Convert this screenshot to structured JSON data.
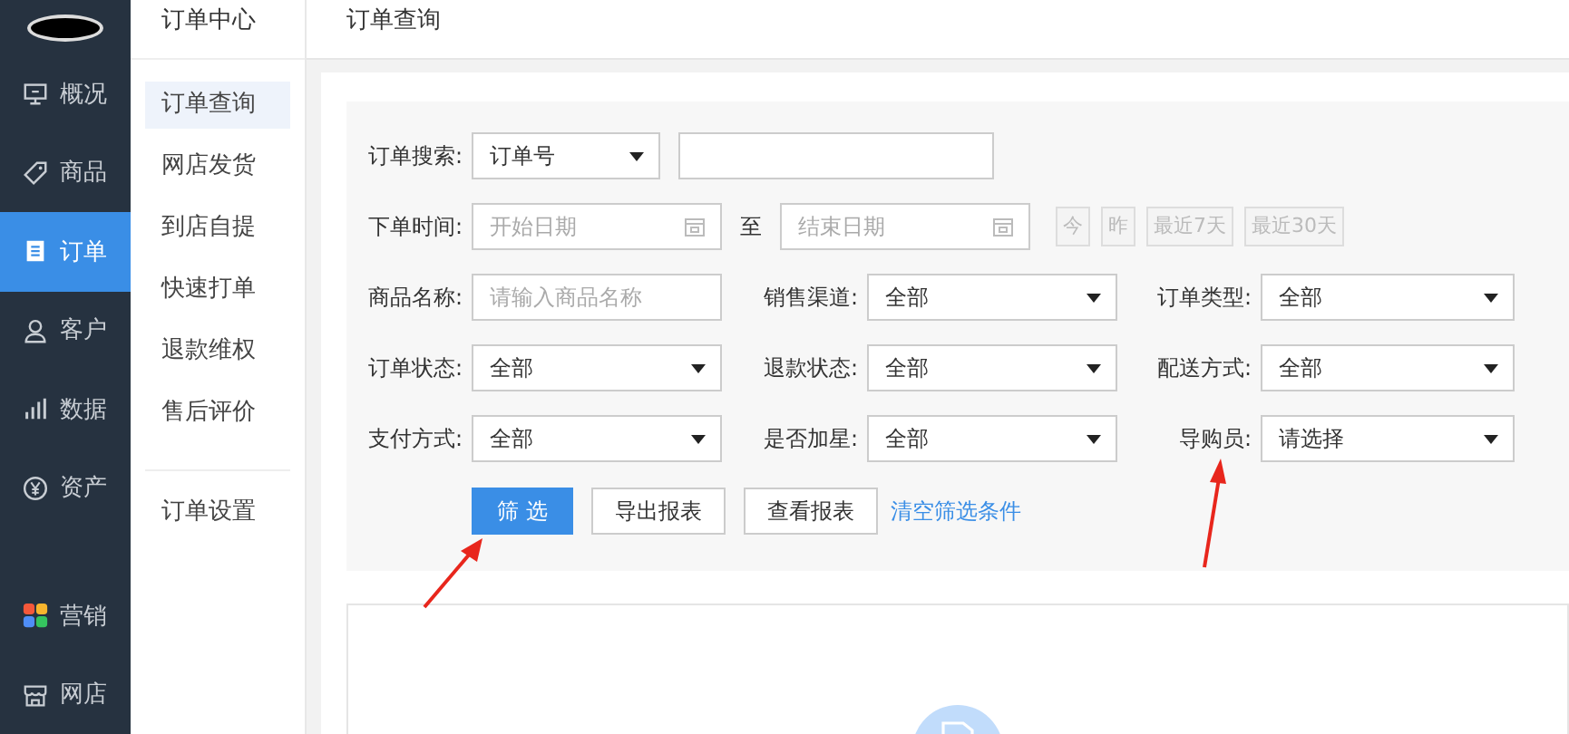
{
  "main_nav": [
    {
      "label": "概况",
      "selected": false
    },
    {
      "label": "商品",
      "selected": false
    },
    {
      "label": "订单",
      "selected": true
    },
    {
      "label": "客户",
      "selected": false
    },
    {
      "label": "数据",
      "selected": false
    },
    {
      "label": "资产",
      "selected": false
    },
    {
      "label": "营销",
      "selected": false
    },
    {
      "label": "网店",
      "selected": false
    }
  ],
  "sub_nav": {
    "title": "订单中心",
    "groups": [
      [
        {
          "label": "订单查询",
          "selected": true
        },
        {
          "label": "网店发货",
          "selected": false
        },
        {
          "label": "到店自提",
          "selected": false
        },
        {
          "label": "快速打单",
          "selected": false
        },
        {
          "label": "退款维权",
          "selected": false
        },
        {
          "label": "售后评价",
          "selected": false
        }
      ],
      [
        {
          "label": "订单设置",
          "selected": false
        }
      ]
    ]
  },
  "page_title": "订单查询",
  "filter": {
    "order_search": {
      "label": "订单搜索:",
      "type_select": "订单号"
    },
    "order_time": {
      "label": "下单时间:",
      "start_placeholder": "开始日期",
      "separator": "至",
      "end_placeholder": "结束日期",
      "quick_dates": [
        {
          "label": "今",
          "disabled": true
        },
        {
          "label": "昨",
          "disabled": true
        },
        {
          "label": "最近7天",
          "disabled": true
        },
        {
          "label": "最近30天",
          "disabled": true
        }
      ]
    },
    "fields": [
      [
        {
          "label": "商品名称:",
          "kind": "text",
          "placeholder": "请输入商品名称"
        },
        {
          "label": "销售渠道:",
          "kind": "select",
          "value": "全部"
        },
        {
          "label": "订单类型:",
          "kind": "select",
          "value": "全部"
        }
      ],
      [
        {
          "label": "订单状态:",
          "kind": "select",
          "value": "全部"
        },
        {
          "label": "退款状态:",
          "kind": "select",
          "value": "全部"
        },
        {
          "label": "配送方式:",
          "kind": "select",
          "value": "全部"
        }
      ],
      [
        {
          "label": "支付方式:",
          "kind": "select",
          "value": "全部"
        },
        {
          "label": "是否加星:",
          "kind": "select",
          "value": "全部"
        },
        {
          "label": "导购员:",
          "kind": "select",
          "value": "请选择"
        }
      ]
    ],
    "actions": [
      {
        "kind": "primary",
        "label": "筛 选"
      },
      {
        "kind": "default",
        "label": "导出报表"
      },
      {
        "kind": "default",
        "label": "查看报表"
      },
      {
        "kind": "link",
        "label": "清空筛选条件"
      }
    ]
  }
}
